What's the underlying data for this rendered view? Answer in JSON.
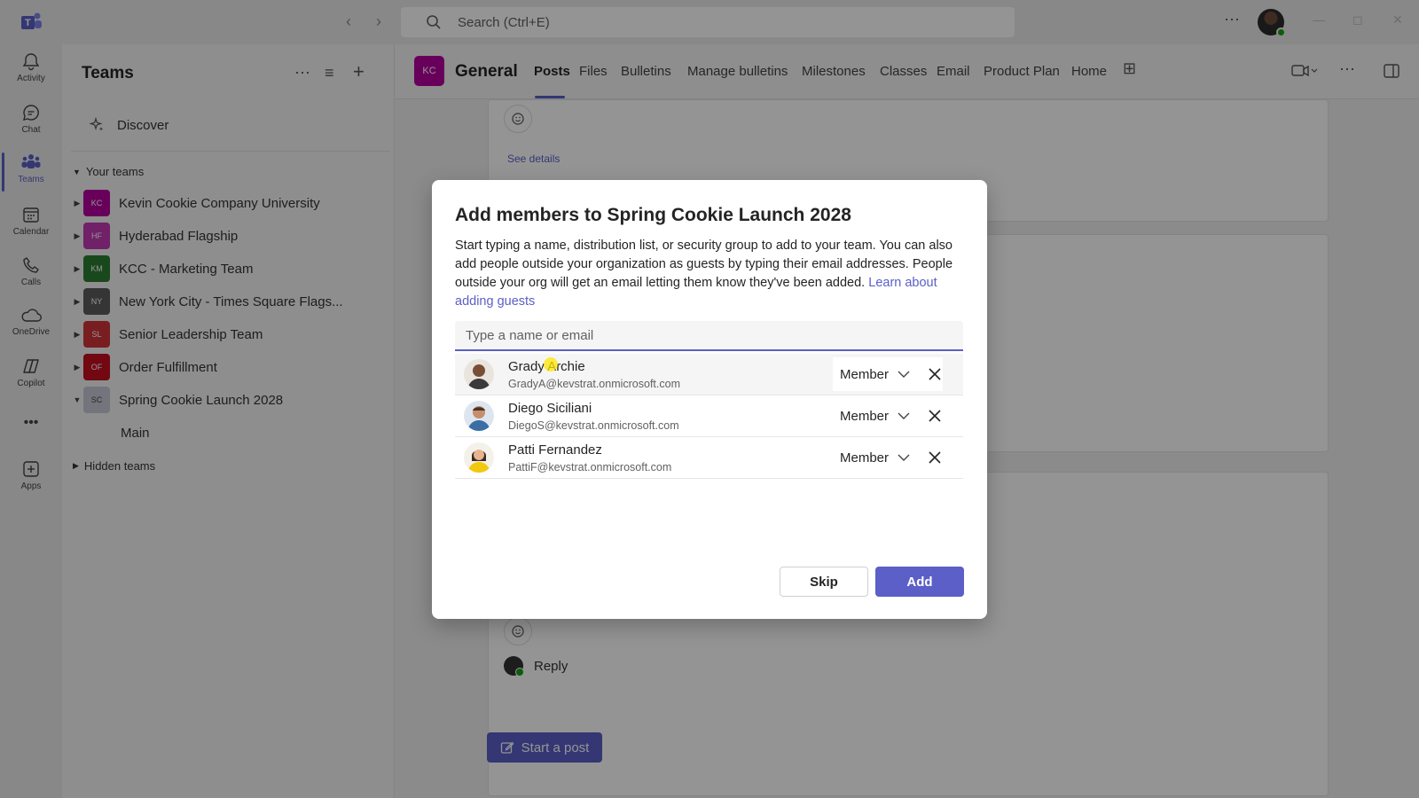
{
  "titlebar": {
    "search_placeholder": "Search (Ctrl+E)"
  },
  "rail": {
    "items": [
      {
        "label": "Activity",
        "icon": "bell-icon"
      },
      {
        "label": "Chat",
        "icon": "chat-icon"
      },
      {
        "label": "Teams",
        "icon": "teams-icon",
        "active": true
      },
      {
        "label": "Calendar",
        "icon": "calendar-icon"
      },
      {
        "label": "Calls",
        "icon": "phone-icon"
      },
      {
        "label": "OneDrive",
        "icon": "cloud-icon"
      },
      {
        "label": "Copilot",
        "icon": "copilot-icon"
      },
      {
        "label": "Apps",
        "icon": "add-apps-icon"
      }
    ]
  },
  "panel": {
    "title": "Teams",
    "discover": "Discover",
    "your_teams": "Your teams",
    "hidden_teams": "Hidden teams",
    "teams": [
      {
        "initials": "KC",
        "name": "Kevin Cookie Company University",
        "color": "#b4009e"
      },
      {
        "initials": "HF",
        "name": "Hyderabad Flagship",
        "color": "#c239b3"
      },
      {
        "initials": "KM",
        "name": "KCC - Marketing Team",
        "color": "#2e7d32"
      },
      {
        "initials": "NY",
        "name": "New York City - Times Square Flags...",
        "color": "#5c5c5c"
      },
      {
        "initials": "SL",
        "name": "Senior Leadership Team",
        "color": "#d13438"
      },
      {
        "initials": "OF",
        "name": "Order Fulfillment",
        "color": "#c50f1f"
      },
      {
        "initials": "SC",
        "name": "Spring Cookie Launch 2028",
        "color": "#c8c8d8"
      }
    ],
    "sub_channel": "Main"
  },
  "channel": {
    "initials": "KC",
    "name": "General",
    "tabs": [
      "Posts",
      "Files",
      "Bulletins",
      "Manage bulletins",
      "Milestones",
      "Classes",
      "Email",
      "Product Plan",
      "Home"
    ],
    "active_tab": "Posts",
    "see_details": "See details",
    "reply": "Reply",
    "start_post": "Start a post"
  },
  "dialog": {
    "title": "Add members to Spring Cookie Launch 2028",
    "description": "Start typing a name, distribution list, or security group to add to your team. You can also add people outside your organization as guests by typing their email addresses. People outside your org will get an email letting them know they've been added.",
    "learn_link": "Learn about adding guests",
    "input_placeholder": "Type a name or email",
    "members": [
      {
        "name": "Grady Archie",
        "email": "GradyA@kevstrat.onmicrosoft.com",
        "role": "Member"
      },
      {
        "name": "Diego Siciliani",
        "email": "DiegoS@kevstrat.onmicrosoft.com",
        "role": "Member"
      },
      {
        "name": "Patti Fernandez",
        "email": "PattiF@kevstrat.onmicrosoft.com",
        "role": "Member"
      }
    ],
    "skip_label": "Skip",
    "add_label": "Add"
  },
  "colors": {
    "brand": "#5b5fc7",
    "overlay": "rgba(0,0,0,0.42)"
  }
}
